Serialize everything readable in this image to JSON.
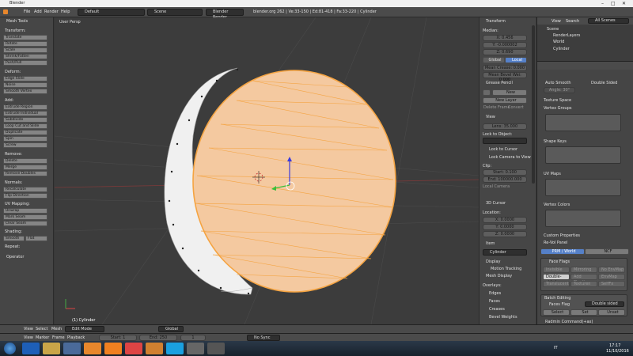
{
  "window": {
    "title": "Blender"
  },
  "menu": {
    "file": "File",
    "add": "Add",
    "render": "Render",
    "help": "Help"
  },
  "header": {
    "layout": "Default",
    "scene": "Scene",
    "engine": "Blender Render",
    "stats": "blender.org 262 | Ve:33-150 | Ed:81-418 | Fa:33-220 | Cylinder"
  },
  "toolshelf": {
    "title": "Mesh Tools",
    "transform_hdr": "Transform:",
    "transform": [
      "Translate",
      "Rotate",
      "Scale",
      "Shrink/Fatten",
      "Push/Pull"
    ],
    "deform_hdr": "Deform:",
    "deform": [
      "Edge Slide",
      "Noise",
      "Smooth Vertex"
    ],
    "add_hdr": "Add:",
    "add": [
      "Extrude Region",
      "Extrude Individual",
      "Subdivide",
      "Loop Cut and Slide",
      "Duplicate",
      "Spin",
      "Screw"
    ],
    "remove_hdr": "Remove:",
    "remove": [
      "Delete",
      "Merge",
      "Remove Doubles"
    ],
    "normals_hdr": "Normals:",
    "normals": [
      "Recalculate",
      "Flip Direction"
    ],
    "uv_hdr": "UV Mapping:",
    "uv": [
      "Unwrap",
      "Mark Seam",
      "Clear Seam"
    ],
    "shading_hdr": "Shading:",
    "shading": [
      "Smooth",
      "Flat"
    ],
    "repeat_hdr": "Repeat:",
    "operator": "Operator"
  },
  "viewport": {
    "label": "User Persp",
    "object": "(1) Cylinder"
  },
  "npanel": {
    "transform": "Transform",
    "median": "Median:",
    "x": "X: 0.456",
    "y": "Y: -0.000002",
    "z": "Z: 0.690",
    "global": "Global",
    "local": "Local",
    "crease": "Mean Crease: 0.000",
    "bevel": "Mean Bevel Wei: 0.000",
    "grease": "Grease Pencil",
    "new": "New",
    "new_layer": "New Layer",
    "delete_frame": "Delete Frame",
    "convert": "Convert",
    "view": "View",
    "lens": "Lens: 35.000",
    "lock_object": "Lock to Object:",
    "lock_cursor": "Lock to Cursor",
    "lock_camera": "Lock Camera to View",
    "clip": "Clip:",
    "clip_start": "Start: 0.100",
    "clip_end": "End: 100000.000",
    "local_camera": "Local Camera",
    "cursor": "3D Cursor",
    "location": "Location:",
    "cx": "X: 0.0000",
    "cy": "Y: 0.0000",
    "cz": "Z: 0.0000",
    "item": "Item",
    "item_name": "Cylinder",
    "display": "Display",
    "motion": "Motion Tracking",
    "mesh_display": "Mesh Display",
    "overlays": "Overlays:",
    "edges": "Edges",
    "faces": "Faces",
    "creases": "Creases",
    "bevel_weights": "Bevel Weights"
  },
  "outliner": {
    "view": "View",
    "search": "Search",
    "all_scenes": "All Scenes",
    "scene": "Scene",
    "render_layers": "RenderLayers",
    "world": "World",
    "cylinder": "Cylinder"
  },
  "props": {
    "auto_smooth": "Auto Smooth",
    "double_sided": "Double Sided",
    "angle": "Angle: 30°",
    "texture_space": "Texture Space",
    "vertex_groups": "Vertex Groups",
    "shape_keys": "Shape Keys",
    "uv_maps": "UV Maps",
    "vertex_colors": "Vertex Colors",
    "custom_props": "Custom Properties",
    "rvg": "Re-Vol Panel",
    "prm": "PRM / World",
    "ncf": "NCF",
    "face_flags": "Face Flags",
    "ff_row1": [
      "Invisible",
      "Mirroring",
      "No EnvMap"
    ],
    "ff_row2": [
      "Double-sided",
      "Add Shading",
      "EnvMap"
    ],
    "ff_row3": [
      "Translucent",
      "Texturen",
      "SelfFx"
    ],
    "batch": "Batch Editing",
    "faces_flag": "Faces Flag",
    "double_sided_sel": "Double sided",
    "select": "Select",
    "set": "Set",
    "unset": "Unset",
    "radmin": "Radmin Command(+ax)"
  },
  "viewhdr": {
    "view": "View",
    "select": "Select",
    "mesh": "Mesh",
    "mode": "Edit Mode",
    "orient": "Global"
  },
  "timeline": {
    "view": "View",
    "marker": "Marker",
    "frame": "Frame",
    "playback": "Playback",
    "start": "Start: 1",
    "end": "End: 250",
    "current": "1",
    "sync": "No Sync"
  },
  "taskbar": {
    "lang": "IT",
    "time": "17:17",
    "date": "11/10/2016"
  },
  "colors": {
    "face": "#f4c9a0",
    "edge": "#f5a442",
    "mesh": "#f0f0f0"
  }
}
